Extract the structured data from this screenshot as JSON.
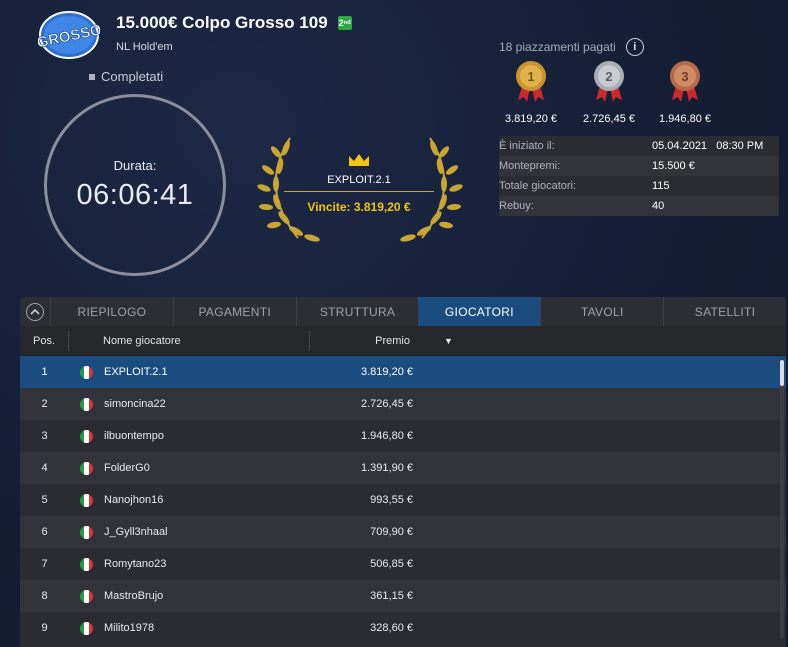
{
  "header": {
    "logo_text": "GROSSO",
    "title": "15.000€ Colpo Grosso 109",
    "badge": "2ⁿᵈ",
    "game": "NL Hold'em",
    "status": "Completati"
  },
  "timer": {
    "label": "Durata:",
    "value": "06:06:41"
  },
  "winner": {
    "name": "EXPLOIT.2.1",
    "prize": "Vincite: 3.819,20 €"
  },
  "payouts": {
    "paid_places": "18 piazzamenti pagati",
    "info_icon": "i",
    "medals": [
      {
        "rank": "1",
        "amount": "3.819,20 €",
        "color": "#c8952e"
      },
      {
        "rank": "2",
        "amount": "2.726,45 €",
        "color": "#a9acb3"
      },
      {
        "rank": "3",
        "amount": "1.946,80 €",
        "color": "#b46a48"
      }
    ]
  },
  "stats": [
    {
      "label": "È iniziato il:",
      "value": "05.04.2021   08:30 PM"
    },
    {
      "label": "Montepremi:",
      "value": "15.500 €"
    },
    {
      "label": "Totale giocatori:",
      "value": "115"
    },
    {
      "label": "Rebuy:",
      "value": "40"
    }
  ],
  "tabs": [
    "RIEPILOGO",
    "PAGAMENTI",
    "STRUTTURA",
    "GIOCATORI",
    "TAVOLI",
    "SATELLITI"
  ],
  "active_tab": "GIOCATORI",
  "table": {
    "headers": {
      "pos": "Pos.",
      "name": "Nome giocatore",
      "prize": "Premio",
      "sort_icon": "▼"
    },
    "rows": [
      {
        "pos": "1",
        "name": "EXPLOIT.2.1",
        "prize": "3.819,20 €"
      },
      {
        "pos": "2",
        "name": "simoncina22",
        "prize": "2.726,45 €"
      },
      {
        "pos": "3",
        "name": "ilbuontempo",
        "prize": "1.946,80 €"
      },
      {
        "pos": "4",
        "name": "FolderG0",
        "prize": "1.391,90 €"
      },
      {
        "pos": "5",
        "name": "Nanojhon16",
        "prize": "993,55 €"
      },
      {
        "pos": "6",
        "name": "J_Gyll3nhaal",
        "prize": "709,90 €"
      },
      {
        "pos": "7",
        "name": "Romytano23",
        "prize": "506,85 €"
      },
      {
        "pos": "8",
        "name": "MastroBrujo",
        "prize": "361,15 €"
      },
      {
        "pos": "9",
        "name": "Milito1978",
        "prize": "328,60 €"
      }
    ]
  },
  "colors": {
    "background": "#17213a",
    "active_tab": "#1b4c80",
    "gold_text": "#f2c417",
    "flag_green": "#1f9b48",
    "flag_white": "#ffffff",
    "flag_red": "#d6333a"
  }
}
